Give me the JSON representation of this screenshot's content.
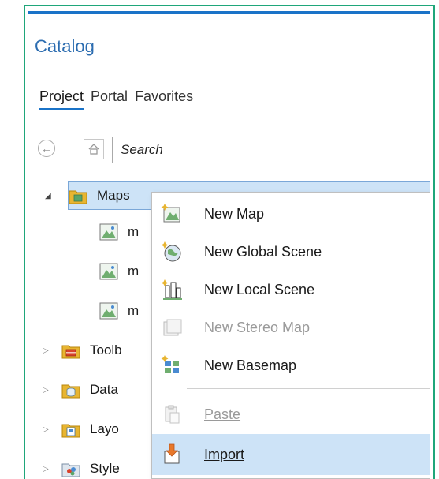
{
  "catalog": {
    "title": "Catalog",
    "tabs": [
      {
        "label": "Project",
        "active": true
      },
      {
        "label": "Portal",
        "active": false
      },
      {
        "label": "Favorites",
        "active": false
      }
    ],
    "search": {
      "placeholder": "Search"
    },
    "tree": [
      {
        "label": "Maps",
        "icon": "maps-folder-icon",
        "expanded": true
      },
      {
        "label": "m",
        "icon": "map-icon"
      },
      {
        "label": "m",
        "icon": "map-icon"
      },
      {
        "label": "m",
        "icon": "map-icon"
      },
      {
        "label": "Toolb",
        "icon": "toolbox-folder-icon"
      },
      {
        "label": "Data",
        "icon": "database-folder-icon"
      },
      {
        "label": "Layo",
        "icon": "layout-folder-icon"
      },
      {
        "label": "Style",
        "icon": "styles-folder-icon"
      }
    ]
  },
  "context_menu": {
    "items": [
      {
        "label": "New Map",
        "icon": "new-map-icon",
        "enabled": true
      },
      {
        "label": "New Global Scene",
        "icon": "new-global-scene-icon",
        "enabled": true
      },
      {
        "label": "New Local Scene",
        "icon": "new-local-scene-icon",
        "enabled": true
      },
      {
        "label": "New Stereo Map",
        "icon": "new-stereo-map-icon",
        "enabled": false
      },
      {
        "label": "New Basemap",
        "icon": "new-basemap-icon",
        "enabled": true
      },
      {
        "label": "Paste",
        "icon": "paste-icon",
        "enabled": false
      },
      {
        "label": "Import",
        "icon": "import-icon",
        "enabled": true,
        "highlighted": true
      }
    ]
  },
  "colors": {
    "frame": "#1fa67a",
    "accent": "#1a73c8",
    "selection": "#cde3f7"
  }
}
